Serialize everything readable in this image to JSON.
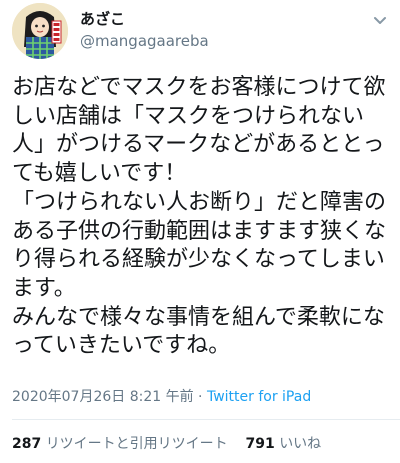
{
  "user": {
    "display_name": "あざこ",
    "handle": "@mangagaareba"
  },
  "tweet": {
    "text": "お店などでマスクをお客様につけて欲しい店舗は「マスクをつけられない人」がつけるマークなどがあるととっても嬉しいです！\n「つけられない人お断り」だと障害のある子供の行動範囲はますます狭くなり得られる経験が少なくなってしまいます。\nみんなで様々な事情を組んで柔軟になっていきたいですね。",
    "timestamp": "2020年07月26日 8:21 午前",
    "separator": " · ",
    "source": "Twitter for iPad"
  },
  "stats": {
    "retweets": "287",
    "retweets_label": "リツイートと引用リツイート",
    "likes": "791",
    "likes_label": "いいね"
  },
  "colors": {
    "text": "#14171a",
    "secondary": "#657786",
    "link": "#1da1f2",
    "divider": "#e6ecf0"
  },
  "icons": {
    "menu": "chevron-down-icon"
  }
}
